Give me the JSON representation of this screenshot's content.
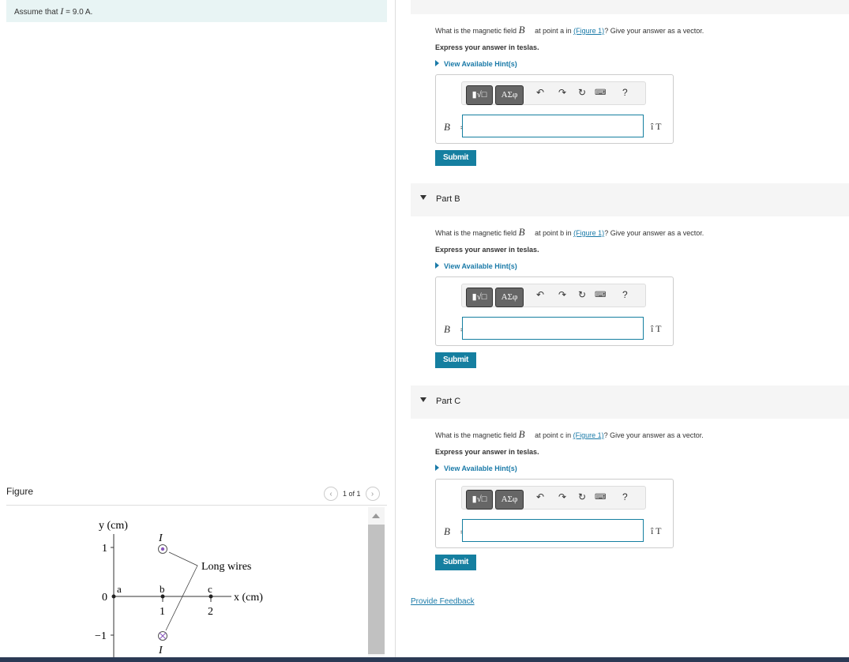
{
  "assumption": {
    "prefix": "Assume that ",
    "var": "I",
    "value": " = 9.0 A."
  },
  "figure": {
    "title": "Figure",
    "pager": "1 of 1",
    "y_axis_label": "y (cm)",
    "x_axis_label": "x (cm)",
    "y_ticks": [
      "1",
      "0",
      "−1"
    ],
    "x_ticks": [
      "1",
      "2"
    ],
    "points": [
      "a",
      "b",
      "c"
    ],
    "current_label": "I",
    "wire_label": "Long wires"
  },
  "parts": [
    {
      "header": "",
      "question_pre": "What is the magnetic field ",
      "vector": "B⃗",
      "question_mid": " at point a in ",
      "figure_link": "(Figure 1)",
      "question_post": "? Give your answer as a vector.",
      "express": "Express your answer in teslas.",
      "hint": "View Available Hint(s)",
      "templates_btn": "▮√□",
      "symbols_btn": "ΑΣφ",
      "help": "?",
      "b_label": "B⃗",
      "eq": " =",
      "input_value": "",
      "unit": "î T",
      "submit": "Submit"
    },
    {
      "header": "Part B",
      "question_pre": "What is the magnetic field ",
      "vector": "B⃗",
      "question_mid": " at point b in ",
      "figure_link": "(Figure 1)",
      "question_post": "? Give your answer as a vector.",
      "express": "Express your answer in teslas.",
      "hint": "View Available Hint(s)",
      "templates_btn": "▮√□",
      "symbols_btn": "ΑΣφ",
      "help": "?",
      "b_label": "B⃗",
      "eq": " =",
      "input_value": "",
      "unit": "î T",
      "submit": "Submit"
    },
    {
      "header": "Part C",
      "question_pre": "What is the magnetic field ",
      "vector": "B⃗",
      "question_mid": " at point c in ",
      "figure_link": "(Figure 1)",
      "question_post": "? Give your answer as a vector.",
      "express": "Express your answer in teslas.",
      "hint": "View Available Hint(s)",
      "templates_btn": "▮√□",
      "symbols_btn": "ΑΣφ",
      "help": "?",
      "b_label": "B⃗",
      "eq": " =",
      "input_value": "",
      "unit": "î T",
      "submit": "Submit"
    }
  ],
  "feedback": "Provide Feedback"
}
